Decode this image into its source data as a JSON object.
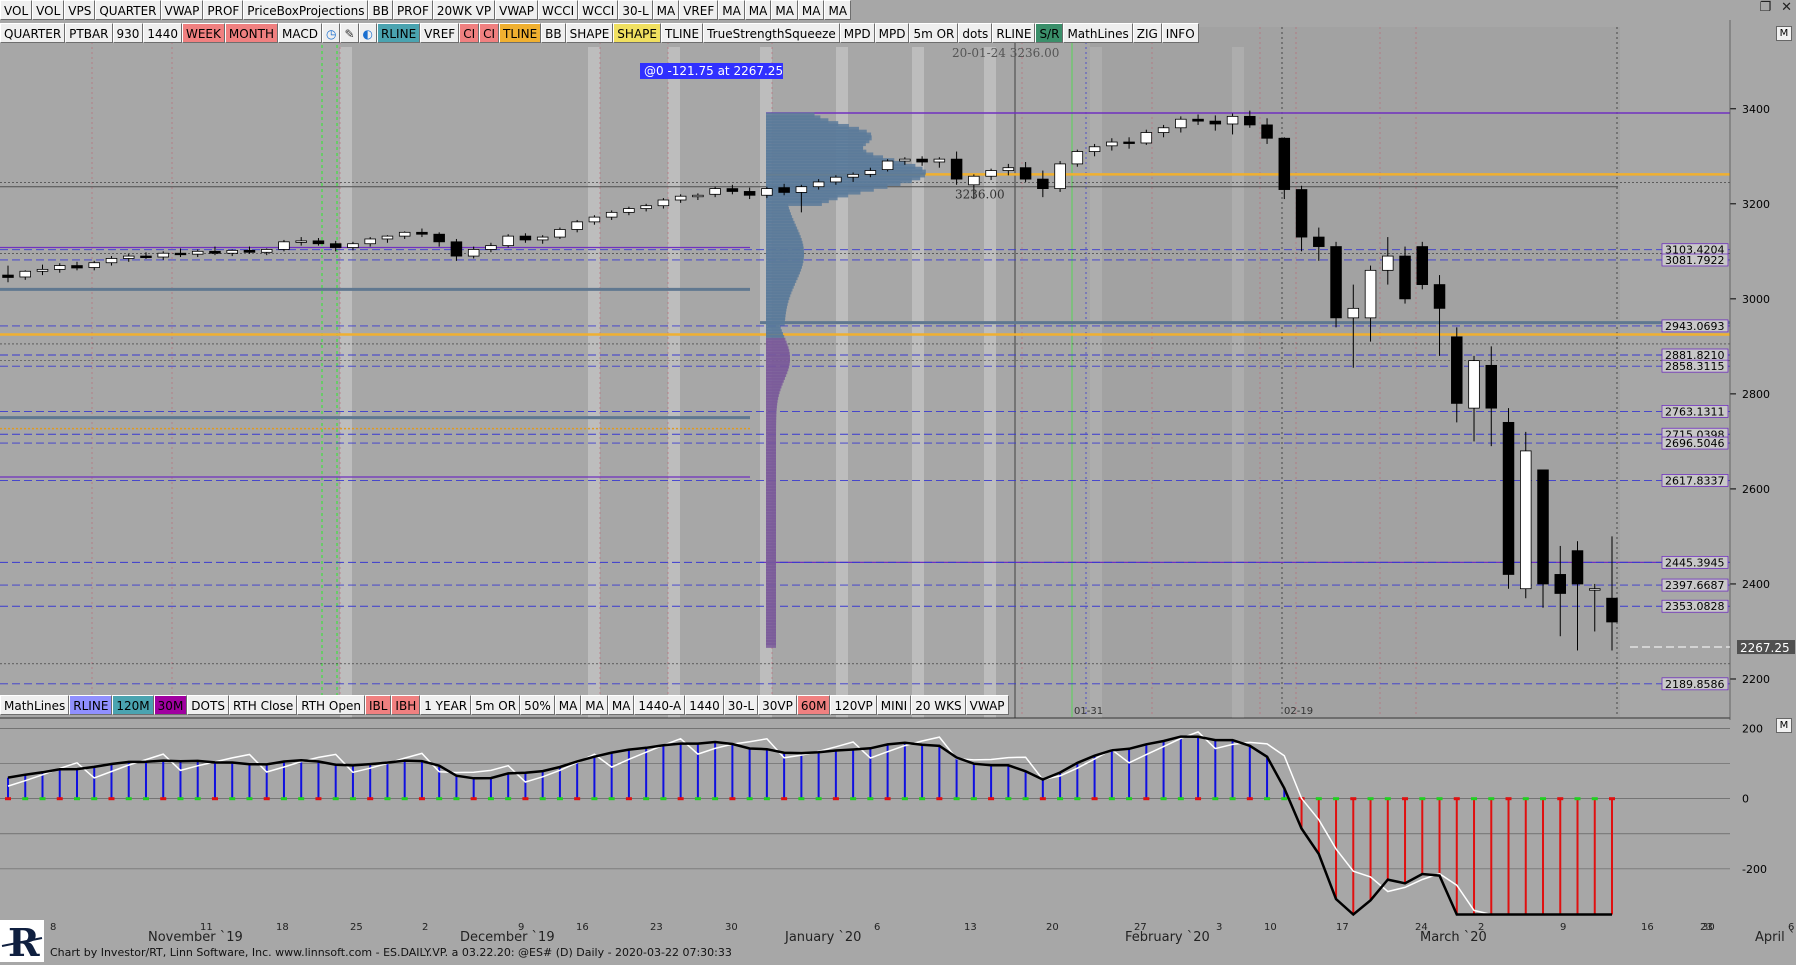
{
  "toolbar_top": [
    {
      "label": "VOL",
      "state": "normal"
    },
    {
      "label": "VOL",
      "state": "normal"
    },
    {
      "label": "VPS",
      "state": "normal"
    },
    {
      "label": "QUARTER",
      "state": "normal"
    },
    {
      "label": "VWAP",
      "state": "normal"
    },
    {
      "label": "PROF",
      "state": "normal"
    },
    {
      "label": "PriceBoxProjections",
      "state": "normal"
    },
    {
      "label": "BB",
      "state": "normal"
    },
    {
      "label": "PROF",
      "state": "normal"
    },
    {
      "label": "20WK VP",
      "state": "normal"
    },
    {
      "label": "VWAP",
      "state": "normal"
    },
    {
      "label": "WCCI",
      "state": "normal"
    },
    {
      "label": "WCCI",
      "state": "normal"
    },
    {
      "label": "30-L",
      "state": "normal"
    },
    {
      "label": "MA",
      "state": "normal"
    },
    {
      "label": "VREF",
      "state": "normal"
    },
    {
      "label": "MA",
      "state": "normal"
    },
    {
      "label": "MA",
      "state": "normal"
    },
    {
      "label": "MA",
      "state": "normal"
    },
    {
      "label": "MA",
      "state": "normal"
    },
    {
      "label": "MA",
      "state": "normal"
    }
  ],
  "toolbar_second": [
    {
      "label": "QUARTER",
      "bg": "#efefef"
    },
    {
      "label": "PTBAR",
      "bg": "#efefef"
    },
    {
      "label": "930",
      "bg": "#efefef"
    },
    {
      "label": "1440",
      "bg": "#efefef"
    },
    {
      "label": "WEEK",
      "bg": "#f08080"
    },
    {
      "label": "MONTH",
      "bg": "#f08080"
    },
    {
      "label": "MACD",
      "bg": "#efefef"
    },
    {
      "label": "",
      "bg": "#efefef",
      "icon": "clock-icon"
    },
    {
      "label": "",
      "bg": "#efefef",
      "icon": "pencil-icon"
    },
    {
      "label": "",
      "bg": "#efefef",
      "icon": "drop-icon"
    },
    {
      "label": "RLINE",
      "bg": "#4aa3b0"
    },
    {
      "label": "VREF",
      "bg": "#efefef"
    },
    {
      "label": "CI",
      "bg": "#f08080"
    },
    {
      "label": "CI",
      "bg": "#f08080"
    },
    {
      "label": "TLINE",
      "bg": "#f0b030"
    },
    {
      "label": "BB",
      "bg": "#efefef"
    },
    {
      "label": "SHAPE",
      "bg": "#efefef"
    },
    {
      "label": "SHAPE",
      "bg": "#f0e060"
    },
    {
      "label": "TLINE",
      "bg": "#efefef"
    },
    {
      "label": "TrueStrengthSqueeze",
      "bg": "#efefef"
    },
    {
      "label": "MPD",
      "bg": "#efefef"
    },
    {
      "label": "MPD",
      "bg": "#efefef"
    },
    {
      "label": "5m OR",
      "bg": "#efefef"
    },
    {
      "label": "dots",
      "bg": "#efefef"
    },
    {
      "label": "RLINE",
      "bg": "#efefef"
    },
    {
      "label": "S/R",
      "bg": "#3a8f6a"
    },
    {
      "label": "MathLines",
      "bg": "#efefef"
    },
    {
      "label": "ZIG",
      "bg": "#efefef"
    },
    {
      "label": "INFO",
      "bg": "#efefef"
    }
  ],
  "toolbar_bottom": [
    {
      "label": "MathLines",
      "bg": "#efefef"
    },
    {
      "label": "RLINE",
      "bg": "#9090ff"
    },
    {
      "label": "120M",
      "bg": "#4aa3b0"
    },
    {
      "label": "30M",
      "bg": "#a000a0"
    },
    {
      "label": "DOTS",
      "bg": "#efefef"
    },
    {
      "label": "RTH Close",
      "bg": "#efefef"
    },
    {
      "label": "RTH Open",
      "bg": "#efefef"
    },
    {
      "label": "IBL",
      "bg": "#f08080"
    },
    {
      "label": "IBH",
      "bg": "#f08080"
    },
    {
      "label": "1 YEAR",
      "bg": "#efefef"
    },
    {
      "label": "5m OR",
      "bg": "#efefef"
    },
    {
      "label": "50%",
      "bg": "#efefef"
    },
    {
      "label": "MA",
      "bg": "#efefef"
    },
    {
      "label": "MA",
      "bg": "#efefef"
    },
    {
      "label": "MA",
      "bg": "#efefef"
    },
    {
      "label": "1440-A",
      "bg": "#efefef"
    },
    {
      "label": "1440",
      "bg": "#efefef"
    },
    {
      "label": "30-L",
      "bg": "#efefef"
    },
    {
      "label": "30VP",
      "bg": "#efefef"
    },
    {
      "label": "60M",
      "bg": "#f08080"
    },
    {
      "label": "120VP",
      "bg": "#efefef"
    },
    {
      "label": "MINI",
      "bg": "#efefef"
    },
    {
      "label": "20 WKS",
      "bg": "#efefef"
    },
    {
      "label": "VWAP",
      "bg": "#efefef"
    }
  ],
  "annotations": {
    "cursor_info": "@0 -121.75 at 2267.25",
    "crosshair_label": "20-01-24 3236.00",
    "vp_label": "3236.00",
    "date_marker_1": "01-31",
    "date_marker_2": "02-19",
    "last_price": "2267.25"
  },
  "colors": {
    "background": "#a7a7a7",
    "up_candle": "#ffffff",
    "down_candle": "#000000",
    "orange_level": "#f0b030",
    "purple_level": "#7030c0",
    "blue_dash": "#3a3ad0",
    "profile": "#5a7a9a",
    "macd_up": "#1010e0",
    "macd_down": "#e01010",
    "macd_line": "#000000",
    "signal_line": "#ffffff"
  },
  "footer": "Chart by Investor/RT, Linn Software, Inc. www.linnsoft.com - ES.DAILY.VP. a   03.22.20: @ES# (D) Daily - 2020-03-22 07:30:33",
  "chart_data": [
    {
      "type": "candlestick",
      "symbol": "@ES#",
      "timeframe": "Daily",
      "y_axis_ticks": [
        2200,
        2400,
        2600,
        2800,
        3000,
        3200,
        3400
      ],
      "ylim": [
        2120,
        3530
      ],
      "price_levels": [
        3103.4204,
        3081.7922,
        2943.0693,
        2881.821,
        2858.3115,
        2763.1311,
        2715.0398,
        2696.5046,
        2617.8337,
        2445.3945,
        2397.6687,
        2353.0828,
        2189.8586
      ],
      "level_labels": [
        "3103.4204",
        "3081.7922",
        "2943.0693",
        "2881.8210",
        "2858.3115",
        "2763.1311",
        "2715.0398",
        "2696.5046",
        "2617.8337",
        "2445.3945",
        "2397.6687",
        "2353.0828",
        "2189.8586"
      ],
      "x_tick_labels": [
        "8",
        "November `19",
        "11",
        "18",
        "25",
        "2",
        "December `19",
        "9",
        "16",
        "23",
        "30",
        "January `20",
        "6",
        "13",
        "20",
        "27",
        "3",
        "February `20",
        "10",
        "17",
        "24",
        "2",
        "March `20",
        "9",
        "16",
        "23",
        "30",
        "April `20",
        "6"
      ],
      "ohlc": [
        [
          3050,
          3070,
          3035,
          3045
        ],
        [
          3046,
          3060,
          3040,
          3058
        ],
        [
          3058,
          3072,
          3050,
          3062
        ],
        [
          3062,
          3075,
          3055,
          3070
        ],
        [
          3070,
          3078,
          3060,
          3065
        ],
        [
          3066,
          3080,
          3060,
          3076
        ],
        [
          3076,
          3090,
          3070,
          3085
        ],
        [
          3085,
          3095,
          3078,
          3090
        ],
        [
          3090,
          3098,
          3084,
          3088
        ],
        [
          3088,
          3100,
          3082,
          3096
        ],
        [
          3096,
          3106,
          3088,
          3094
        ],
        [
          3094,
          3104,
          3088,
          3100
        ],
        [
          3100,
          3110,
          3092,
          3096
        ],
        [
          3096,
          3104,
          3090,
          3102
        ],
        [
          3102,
          3110,
          3095,
          3098
        ],
        [
          3098,
          3106,
          3092,
          3104
        ],
        [
          3104,
          3124,
          3100,
          3120
        ],
        [
          3120,
          3130,
          3112,
          3122
        ],
        [
          3122,
          3128,
          3112,
          3116
        ],
        [
          3116,
          3122,
          3100,
          3108
        ],
        [
          3108,
          3120,
          3102,
          3116
        ],
        [
          3116,
          3130,
          3110,
          3126
        ],
        [
          3126,
          3134,
          3118,
          3132
        ],
        [
          3132,
          3142,
          3126,
          3140
        ],
        [
          3140,
          3148,
          3130,
          3136
        ],
        [
          3136,
          3140,
          3110,
          3120
        ],
        [
          3120,
          3126,
          3080,
          3090
        ],
        [
          3090,
          3110,
          3085,
          3104
        ],
        [
          3104,
          3118,
          3098,
          3112
        ],
        [
          3112,
          3136,
          3108,
          3132
        ],
        [
          3132,
          3138,
          3118,
          3124
        ],
        [
          3124,
          3134,
          3116,
          3130
        ],
        [
          3130,
          3150,
          3126,
          3146
        ],
        [
          3146,
          3166,
          3140,
          3162
        ],
        [
          3162,
          3176,
          3156,
          3172
        ],
        [
          3172,
          3186,
          3166,
          3182
        ],
        [
          3182,
          3194,
          3176,
          3190
        ],
        [
          3190,
          3200,
          3184,
          3196
        ],
        [
          3196,
          3212,
          3190,
          3208
        ],
        [
          3208,
          3220,
          3202,
          3216
        ],
        [
          3216,
          3222,
          3208,
          3218
        ],
        [
          3220,
          3236,
          3214,
          3232
        ],
        [
          3232,
          3240,
          3220,
          3226
        ],
        [
          3226,
          3234,
          3210,
          3218
        ],
        [
          3218,
          3236,
          3212,
          3232
        ],
        [
          3234,
          3242,
          3218,
          3224
        ],
        [
          3224,
          3240,
          3182,
          3236
        ],
        [
          3236,
          3252,
          3230,
          3246
        ],
        [
          3246,
          3260,
          3240,
          3256
        ],
        [
          3256,
          3266,
          3246,
          3262
        ],
        [
          3262,
          3276,
          3256,
          3270
        ],
        [
          3272,
          3294,
          3268,
          3290
        ],
        [
          3290,
          3298,
          3282,
          3294
        ],
        [
          3294,
          3300,
          3280,
          3288
        ],
        [
          3288,
          3298,
          3276,
          3294
        ],
        [
          3294,
          3310,
          3240,
          3252
        ],
        [
          3240,
          3262,
          3210,
          3258
        ],
        [
          3258,
          3274,
          3250,
          3270
        ],
        [
          3270,
          3284,
          3260,
          3276
        ],
        [
          3276,
          3288,
          3246,
          3252
        ],
        [
          3252,
          3270,
          3214,
          3232
        ],
        [
          3232,
          3290,
          3225,
          3284
        ],
        [
          3284,
          3314,
          3278,
          3310
        ],
        [
          3310,
          3326,
          3300,
          3320
        ],
        [
          3322,
          3338,
          3312,
          3330
        ],
        [
          3330,
          3340,
          3316,
          3328
        ],
        [
          3328,
          3356,
          3324,
          3350
        ],
        [
          3350,
          3366,
          3340,
          3360
        ],
        [
          3360,
          3384,
          3350,
          3378
        ],
        [
          3378,
          3388,
          3366,
          3374
        ],
        [
          3374,
          3386,
          3354,
          3368
        ],
        [
          3368,
          3390,
          3346,
          3384
        ],
        [
          3384,
          3396,
          3360,
          3366
        ],
        [
          3366,
          3380,
          3326,
          3338
        ],
        [
          3338,
          3340,
          3210,
          3230
        ],
        [
          3230,
          3238,
          3100,
          3130
        ],
        [
          3130,
          3150,
          3080,
          3110
        ],
        [
          3110,
          3120,
          2940,
          2960
        ],
        [
          2960,
          3030,
          2855,
          2980
        ],
        [
          2960,
          3070,
          2910,
          3060
        ],
        [
          3060,
          3130,
          3030,
          3090
        ],
        [
          3090,
          3110,
          2990,
          3000
        ],
        [
          3110,
          3120,
          3020,
          3030
        ],
        [
          3030,
          3050,
          2880,
          2980
        ],
        [
          2920,
          2940,
          2740,
          2780
        ],
        [
          2770,
          2880,
          2700,
          2870
        ],
        [
          2860,
          2900,
          2690,
          2770
        ],
        [
          2740,
          2770,
          2390,
          2420
        ],
        [
          2390,
          2720,
          2370,
          2680
        ],
        [
          2640,
          2640,
          2350,
          2400
        ],
        [
          2420,
          2480,
          2290,
          2380
        ],
        [
          2470,
          2490,
          2260,
          2400
        ],
        [
          2390,
          2400,
          2300,
          2390
        ],
        [
          2370,
          2500,
          2260,
          2320
        ]
      ],
      "volume_profile_poc": 3236.0
    },
    {
      "type": "line",
      "name": "MACD",
      "y_axis_ticks": [
        200,
        0,
        -200
      ],
      "ylim": [
        -340,
        230
      ]
    }
  ]
}
